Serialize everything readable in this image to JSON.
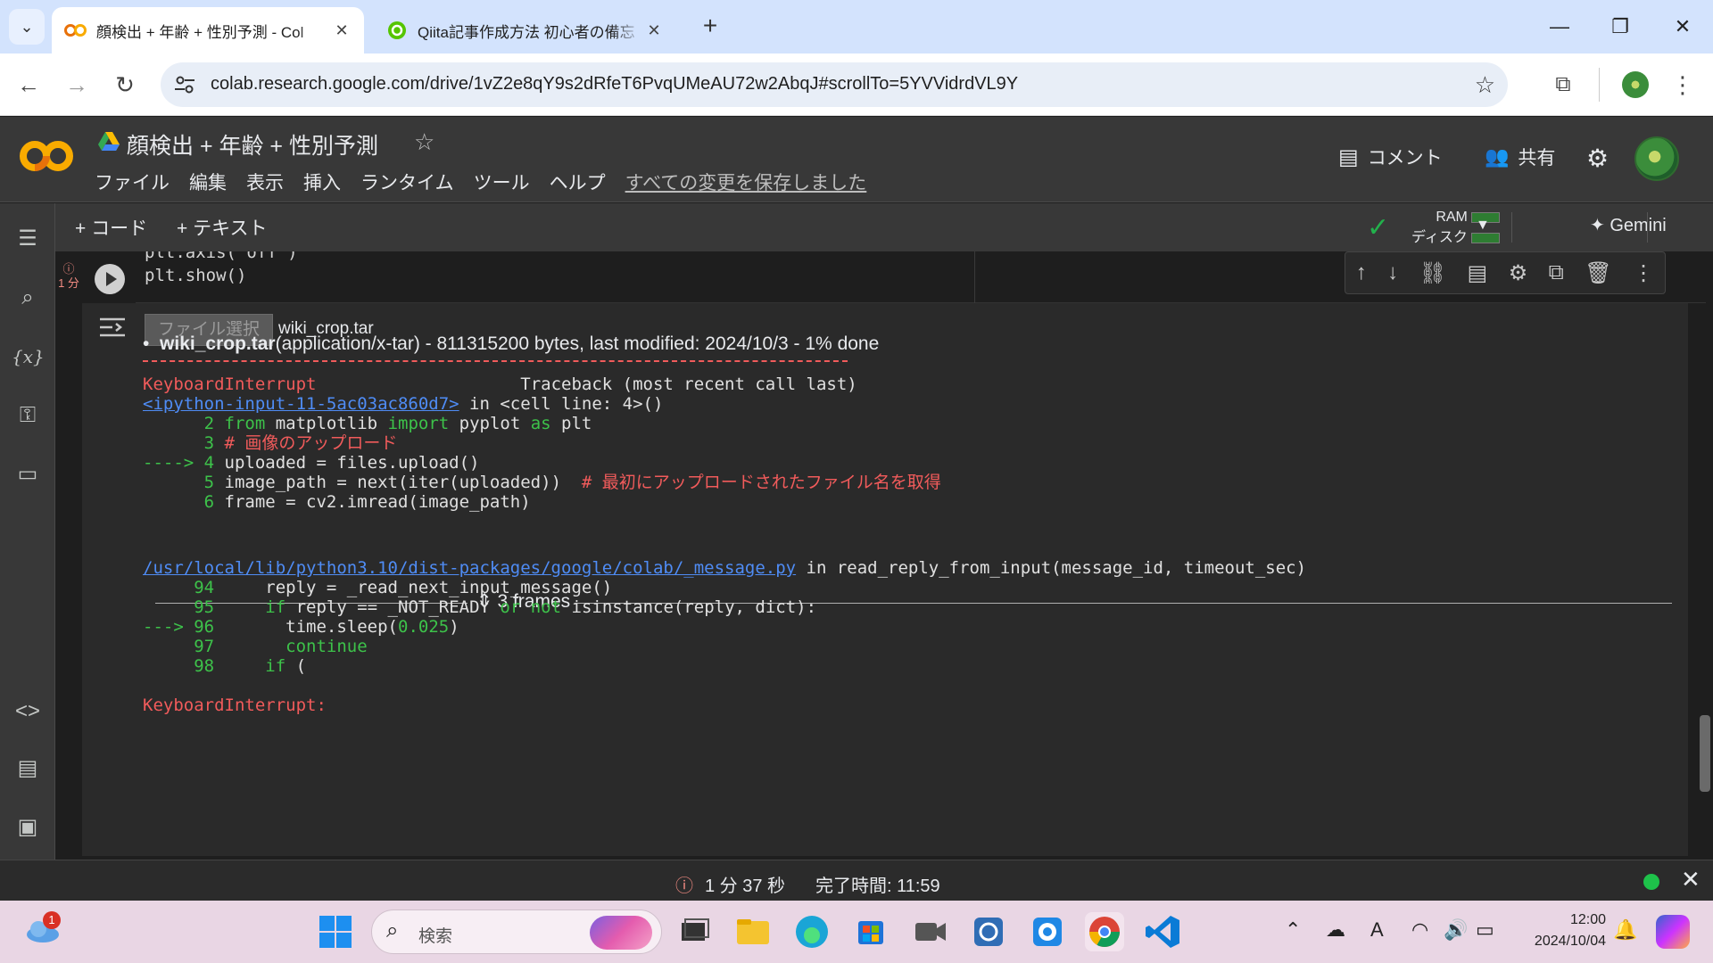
{
  "browser": {
    "tabs": [
      {
        "title": "顔検出 + 年齢 + 性別予測 - Col",
        "active": true,
        "favicon": "colab-icon"
      },
      {
        "title": "Qiita記事作成方法 初心者の備忘",
        "active": false,
        "favicon": "qiita-icon"
      }
    ],
    "url": "colab.research.google.com/drive/1vZ2e8qY9s2dRfeT6PvqUMeAU72w2AbqJ#scrollTo=5YVVidrdVL9Y"
  },
  "colab": {
    "logo": "CO",
    "notebook_title": "顔検出 + 年齢 + 性別予測",
    "menu": [
      "ファイル",
      "編集",
      "表示",
      "挿入",
      "ランタイム",
      "ツール",
      "ヘルプ"
    ],
    "save_status": "すべての変更を保存しました",
    "comment_label": "コメント",
    "share_label": "共有"
  },
  "toolbar": {
    "add_code": "+ コード",
    "add_text": "+ テキスト",
    "ram_label": "RAM",
    "disk_label": "ディスク",
    "gemini_label": "Gemini"
  },
  "cell": {
    "exec_badge": "1 分",
    "code_lines": [
      "plt.axis('off')",
      "plt.show()"
    ]
  },
  "output": {
    "file_button": "ファイル選択",
    "file_name": "wiki_crop.tar",
    "upload_file": "wiki_crop.tar",
    "upload_detail": "(application/x-tar) - 811315200 bytes, last modified: 2024/10/3 - 1% done",
    "traceback": {
      "error_name": "KeyboardInterrupt",
      "traceback_header": "Traceback (most recent call last)",
      "input_link": "<ipython-input-11-5ac03ac860d7>",
      "input_loc": " in <cell line: 4>()",
      "frames_label": "3 frames",
      "module_link": "/usr/local/lib/python3.10/dist-packages/google/colab/_message.py",
      "module_loc": " in read_reply_from_input(message_id, timeout_sec)",
      "final_error": "KeyboardInterrupt:"
    }
  },
  "status": {
    "elapsed": "1 分 37 秒",
    "completed": "完了時間: 11:59"
  },
  "taskbar": {
    "search_placeholder": "検索",
    "notification_count": "1",
    "time": "12:00",
    "date": "2024/10/04",
    "ime": "A"
  }
}
